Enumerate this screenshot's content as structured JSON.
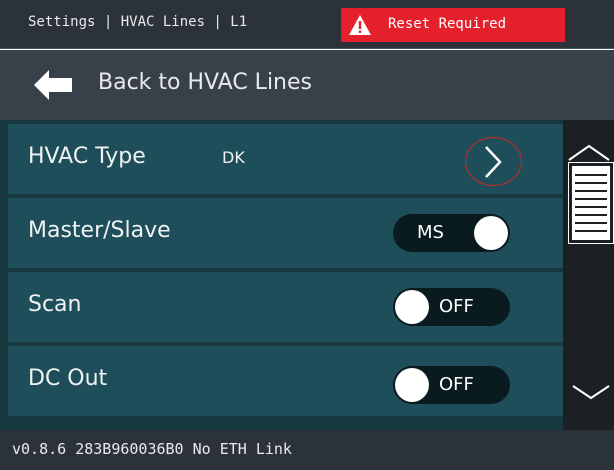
{
  "header": {
    "breadcrumb": "Settings | HVAC Lines | L1",
    "alert_text": "Reset Required",
    "alert_icon": "warning-triangle-icon",
    "alert_color": "#e4202c"
  },
  "nav": {
    "back_label": "Back to HVAC Lines",
    "back_icon": "arrow-left-icon"
  },
  "settings": {
    "rows": [
      {
        "label": "HVAC Type",
        "value": "DK",
        "control": "chevron-right-icon"
      },
      {
        "label": "Master/Slave",
        "toggle_text": "MS",
        "toggle_on": true
      },
      {
        "label": "Scan",
        "toggle_text": "OFF",
        "toggle_on": false
      },
      {
        "label": "DC Out",
        "toggle_text": "OFF",
        "toggle_on": false
      }
    ]
  },
  "scrollbar": {
    "up_icon": "chevron-up-icon",
    "down_icon": "chevron-down-icon"
  },
  "footer": {
    "status": "v0.8.6 283B960036B0 No ETH Link"
  },
  "colors": {
    "row_bg": "#1e4e5a",
    "header_bg": "#2c3239",
    "toggle_bg": "#0a1b20"
  }
}
